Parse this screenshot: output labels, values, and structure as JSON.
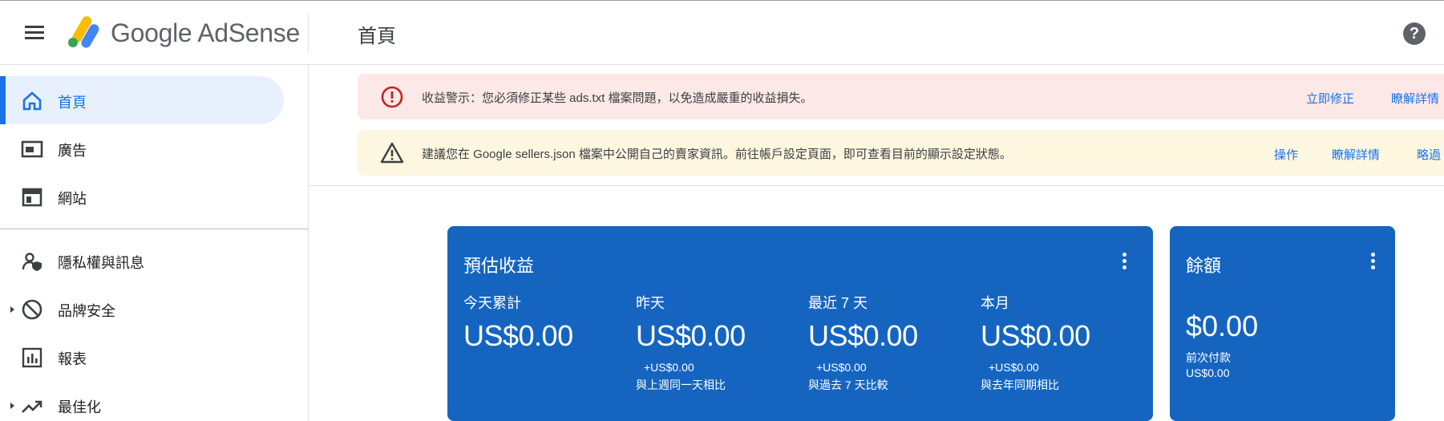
{
  "header": {
    "brand": "Google AdSense",
    "page_title": "首頁",
    "help_label": "?"
  },
  "sidebar": {
    "items": [
      {
        "label": "首頁",
        "icon": "home-icon",
        "active": true
      },
      {
        "label": "廣告",
        "icon": "ad-icon"
      },
      {
        "label": "網站",
        "icon": "sites-icon"
      },
      {
        "label": "隱私權與訊息",
        "icon": "privacy-icon"
      },
      {
        "label": "品牌安全",
        "icon": "block-icon",
        "expandable": true
      },
      {
        "label": "報表",
        "icon": "reports-icon"
      },
      {
        "label": "最佳化",
        "icon": "trending-icon",
        "expandable": true
      }
    ]
  },
  "alerts": {
    "error": {
      "text": "收益警示：您必須修正某些 ads.txt 檔案問題，以免造成嚴重的收益損失。",
      "action_fix": "立即修正",
      "action_learn": "瞭解詳情"
    },
    "warning": {
      "text": "建議您在 Google sellers.json 檔案中公開自己的賣家資訊。前往帳戶設定頁面，即可查看目前的顯示設定狀態。",
      "action_do": "操作",
      "action_learn": "瞭解詳情",
      "action_dismiss": "略過"
    }
  },
  "earnings_card": {
    "title": "預估收益",
    "metrics": [
      {
        "label": "今天累計",
        "value": "US$0.00",
        "delta": "",
        "comparison": ""
      },
      {
        "label": "昨天",
        "value": "US$0.00",
        "delta": "+US$0.00",
        "comparison": "與上週同一天相比"
      },
      {
        "label": "最近 7 天",
        "value": "US$0.00",
        "delta": "+US$0.00",
        "comparison": "與過去 7 天比較"
      },
      {
        "label": "本月",
        "value": "US$0.00",
        "delta": "+US$0.00",
        "comparison": "與去年同期相比"
      }
    ]
  },
  "balance_card": {
    "title": "餘額",
    "value": "$0.00",
    "last_payment_label": "前次付款",
    "last_payment_amount": "US$0.00"
  },
  "colors": {
    "card_blue": "#1565c0",
    "accent": "#1a73e8",
    "error_bg": "#fce8e6",
    "warning_bg": "#fef7e0",
    "error_icon": "#c5221f"
  }
}
